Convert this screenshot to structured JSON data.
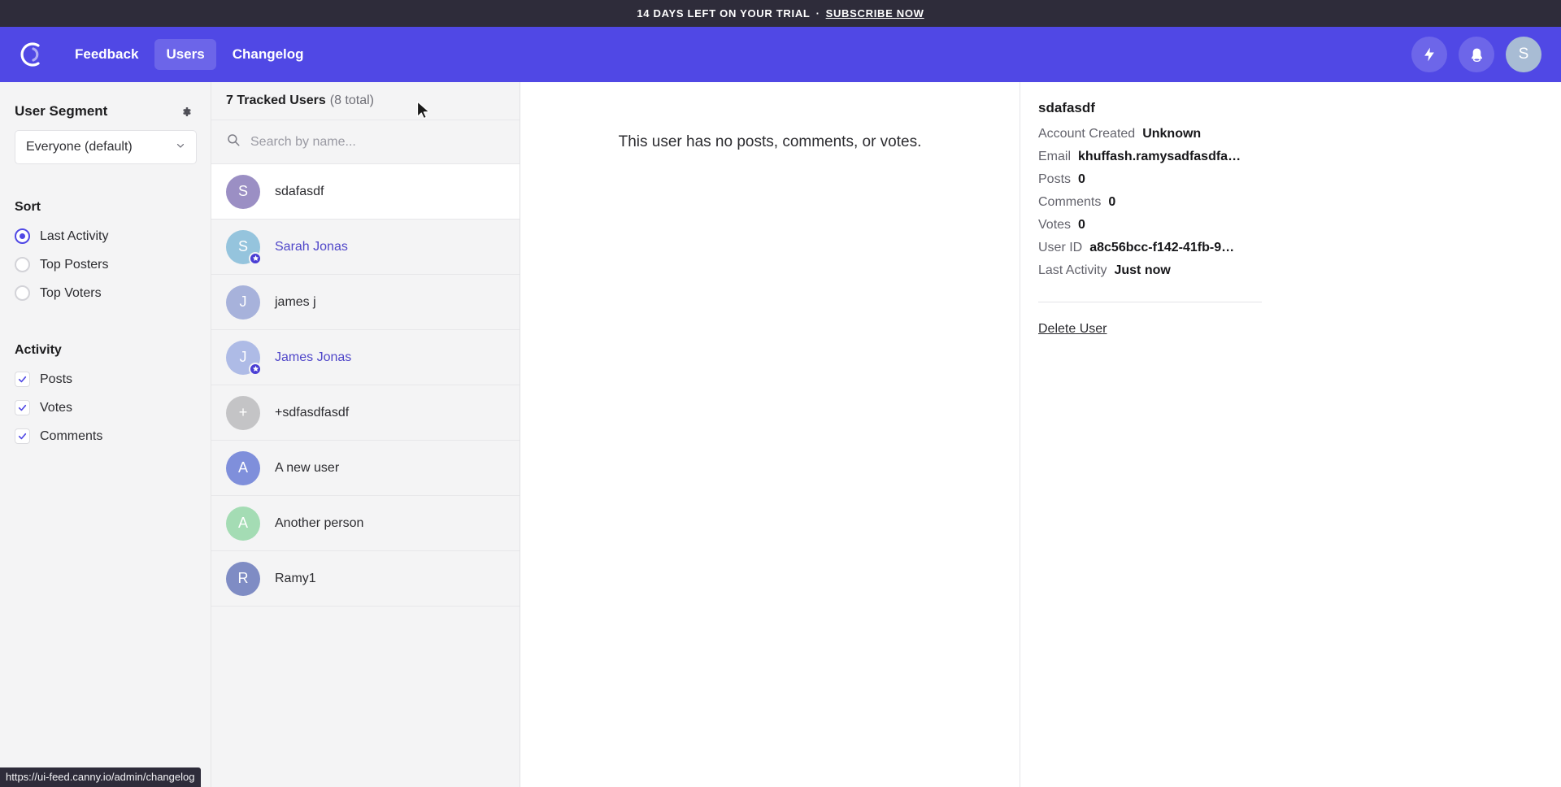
{
  "banner": {
    "text": "14 DAYS LEFT ON YOUR TRIAL",
    "separator": "·",
    "cta": "SUBSCRIBE NOW"
  },
  "topnav": {
    "logo": "C",
    "links": [
      {
        "label": "Feedback",
        "active": false
      },
      {
        "label": "Users",
        "active": true
      },
      {
        "label": "Changelog",
        "active": false
      }
    ],
    "icons": [
      {
        "name": "lightning-bolt-icon"
      },
      {
        "name": "bell-icon"
      }
    ],
    "avatar_initial": "S"
  },
  "sidebar": {
    "segment_title": "User Segment",
    "gear_icon": "gear-icon",
    "segment_selected": "Everyone (default)",
    "sort_title": "Sort",
    "sort_options": [
      {
        "label": "Last Activity",
        "selected": true
      },
      {
        "label": "Top Posters",
        "selected": false
      },
      {
        "label": "Top Voters",
        "selected": false
      }
    ],
    "activity_title": "Activity",
    "activity_options": [
      {
        "label": "Posts",
        "checked": true
      },
      {
        "label": "Votes",
        "checked": true
      },
      {
        "label": "Comments",
        "checked": true
      }
    ]
  },
  "users_panel": {
    "header_count": "7 Tracked Users",
    "header_total": "(8 total)",
    "search_placeholder": "Search by name...",
    "search_value": "",
    "rows": [
      {
        "name": "sdafasdf",
        "initial": "S",
        "color": "#9b8fc4",
        "selected": true,
        "link": false,
        "badge": false
      },
      {
        "name": "Sarah Jonas",
        "initial": "S",
        "color": "#95c4dd",
        "selected": false,
        "link": true,
        "badge": true
      },
      {
        "name": "james j",
        "initial": "J",
        "color": "#a7b2db",
        "selected": false,
        "link": false,
        "badge": false
      },
      {
        "name": "James Jonas",
        "initial": "J",
        "color": "#aebbe6",
        "selected": false,
        "link": true,
        "badge": true
      },
      {
        "name": "+sdfasdfasdf",
        "initial": "+",
        "color": "#c4c4c6",
        "selected": false,
        "link": false,
        "badge": false
      },
      {
        "name": "A new user",
        "initial": "A",
        "color": "#7f8fdb",
        "selected": false,
        "link": false,
        "badge": false
      },
      {
        "name": "Another person",
        "initial": "A",
        "color": "#a4dcb4",
        "selected": false,
        "link": false,
        "badge": false
      },
      {
        "name": "Ramy1",
        "initial": "R",
        "color": "#7f8cc4",
        "selected": false,
        "link": false,
        "badge": false
      }
    ]
  },
  "center": {
    "empty_message": "This user has no posts, comments, or votes."
  },
  "detail": {
    "name": "sdafasdf",
    "fields": [
      {
        "key": "Account Created",
        "value": "Unknown"
      },
      {
        "key": "Email",
        "value": "khuffash.ramysadfasdfa…"
      },
      {
        "key": "Posts",
        "value": "0"
      },
      {
        "key": "Comments",
        "value": "0"
      },
      {
        "key": "Votes",
        "value": "0"
      },
      {
        "key": "User ID",
        "value": "a8c56bcc-f142-41fb-9…"
      },
      {
        "key": "Last Activity",
        "value": "Just now"
      }
    ],
    "delete_label": "Delete User"
  },
  "statusbar": {
    "url": "https://ui-feed.canny.io/admin/changelog"
  },
  "colors": {
    "brand": "#5048e5",
    "banner_bg": "#2e2c3a",
    "link": "#4f46c9"
  }
}
